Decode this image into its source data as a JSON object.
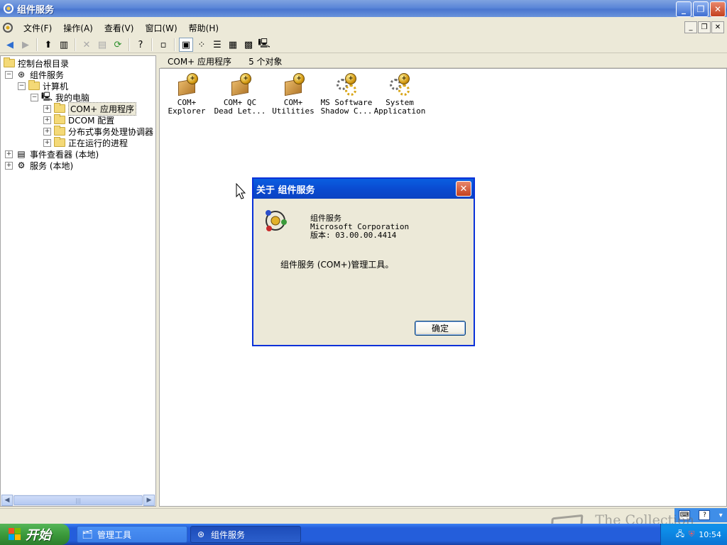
{
  "window": {
    "title": "组件服务",
    "minimize_label": "_",
    "restore_label": "❐",
    "close_label": "✕"
  },
  "menubar": {
    "items": [
      "文件(F)",
      "操作(A)",
      "查看(V)",
      "窗口(W)",
      "帮助(H)"
    ],
    "mdi_minimize": "_",
    "mdi_restore": "❐",
    "mdi_close": "✕"
  },
  "tree": {
    "items": [
      {
        "label": "控制台根目录"
      },
      {
        "label": "组件服务",
        "expander": "−"
      },
      {
        "label": "计算机",
        "expander": "−"
      },
      {
        "label": "我的电脑",
        "expander": "−"
      },
      {
        "label": "COM+ 应用程序",
        "expander": "+"
      },
      {
        "label": "DCOM 配置",
        "expander": "+"
      },
      {
        "label": "分布式事务处理协调器",
        "expander": "+"
      },
      {
        "label": "正在运行的进程",
        "expander": "+"
      },
      {
        "label": "事件查看器 (本地)",
        "expander": "+"
      },
      {
        "label": "服务 (本地)",
        "expander": "+"
      }
    ]
  },
  "right_pane": {
    "header_title": "COM+ 应用程序",
    "header_count": "5 个对象",
    "objects": [
      {
        "line1": "COM+",
        "line2": "Explorer",
        "icon": "package-icon"
      },
      {
        "line1": "COM+ QC",
        "line2": "Dead Let...",
        "icon": "package-icon"
      },
      {
        "line1": "COM+",
        "line2": "Utilities",
        "icon": "package-icon"
      },
      {
        "line1": "MS Software",
        "line2": "Shadow C...",
        "icon": "gear-package-icon"
      },
      {
        "line1": "System",
        "line2": "Application",
        "icon": "gear-package-icon"
      }
    ]
  },
  "dialog": {
    "title": "关于 组件服务",
    "close_label": "✕",
    "product_name": "组件服务",
    "company": "Microsoft Corporation",
    "version": "版本: 03.00.00.4414",
    "description": "组件服务 (COM+)管理工具。",
    "ok_label": "确定"
  },
  "taskbar": {
    "start_label": "开始",
    "buttons": [
      {
        "label": "管理工具",
        "active": false
      },
      {
        "label": "组件服务",
        "active": true
      }
    ],
    "clock": "10:54",
    "watermark": "The Collection Book"
  },
  "colors": {
    "titlebar": "#5b86d8",
    "dialog_title": "#0a4bd1",
    "taskbar": "#245edb",
    "start_button": "#3c9a3c"
  }
}
